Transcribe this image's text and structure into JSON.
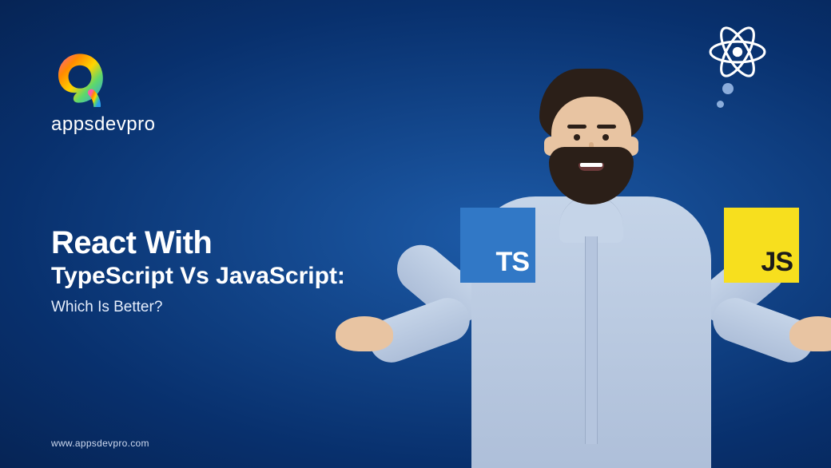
{
  "brand": {
    "name": "appsdevpro"
  },
  "headline": {
    "line1": "React With",
    "line2": "TypeScript Vs JavaScript:",
    "line3": "Which Is Better?"
  },
  "badges": {
    "ts_label": "TS",
    "js_label": "JS"
  },
  "footer": {
    "url": "www.appsdevpro.com"
  },
  "icons": {
    "react": "react-icon"
  }
}
